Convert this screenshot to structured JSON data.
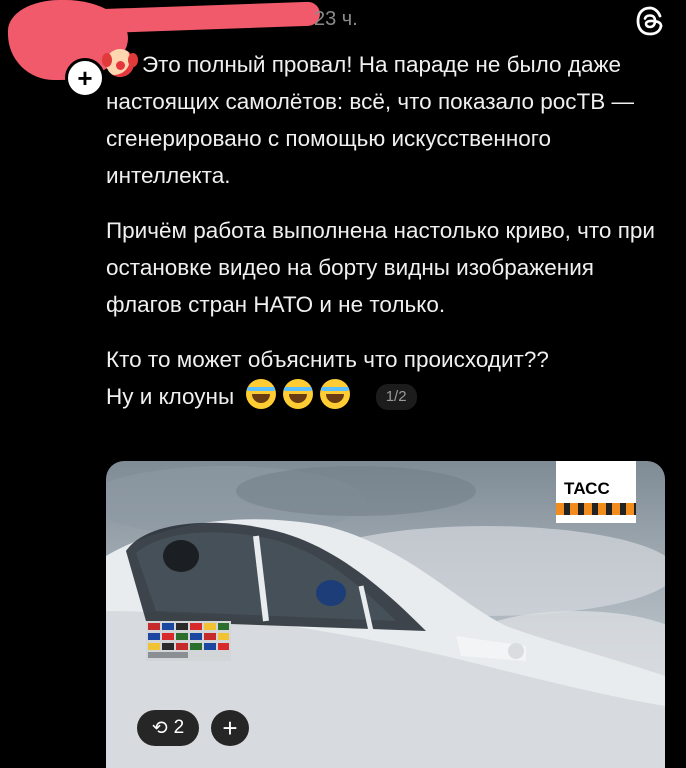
{
  "header": {
    "timestamp": "23 ч.",
    "icons": [
      "threads-logo-icon",
      "follow-plus-icon"
    ]
  },
  "post": {
    "paragraphs": [
      "Это полный провал! На параде не было даже настоящих самолётов: всё, что показало росТВ — сгенерировано с помощью искусственного интеллекта.",
      "Причём работа выполнена настолько криво, что при остановке видео на борту видны изображения флагов стран НАТО и не только.",
      "Кто то может объяснить что происходит??"
    ],
    "last_line": "Ну и клоуны",
    "image_counter": "1/2"
  },
  "media": {
    "watermark": "ТАСС"
  },
  "actions": {
    "repost_count": "2",
    "add_label": "+"
  },
  "colors": {
    "background": "#000000",
    "text": "#f0f0f0",
    "muted": "#8a8a8a",
    "redaction": "#f05a6a"
  }
}
